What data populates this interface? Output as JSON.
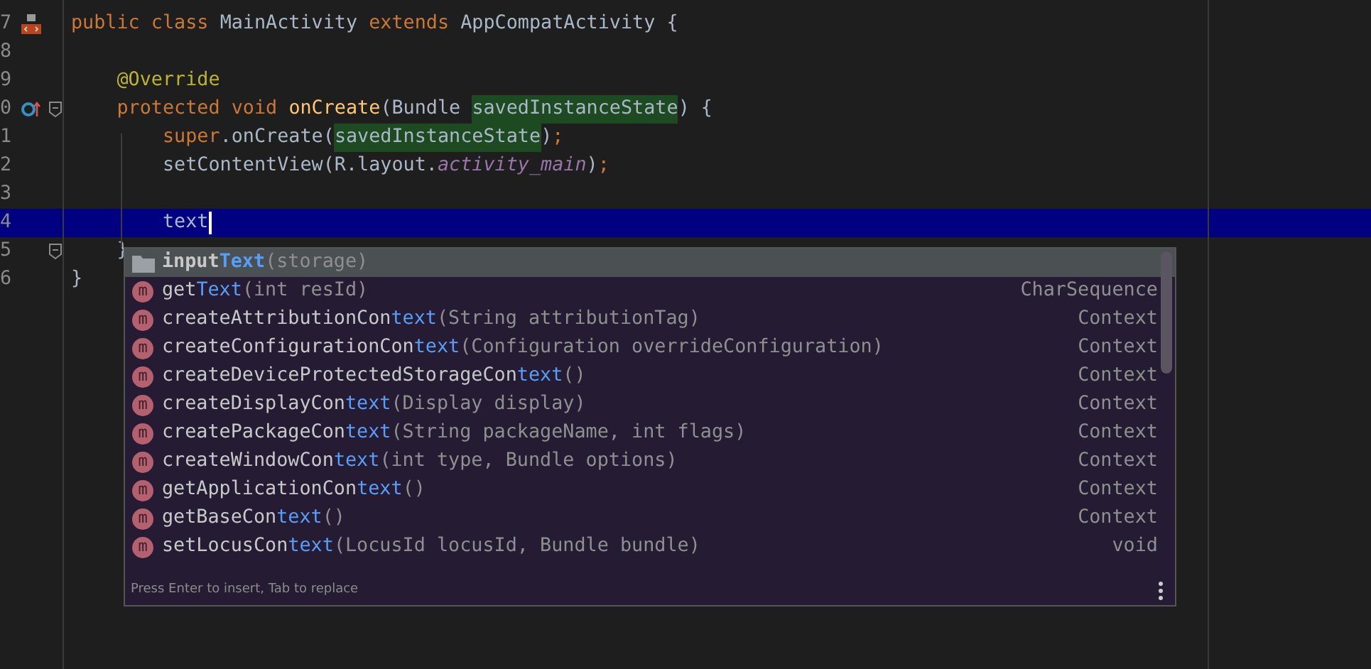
{
  "editor": {
    "lines": [
      {
        "number": "7",
        "kind": "class",
        "fold": false,
        "current": false,
        "segments": [
          {
            "kind": "keyword",
            "text": "public class "
          },
          {
            "kind": "plain",
            "text": "MainActivity "
          },
          {
            "kind": "keyword",
            "text": "extends "
          },
          {
            "kind": "plain",
            "text": "AppCompatActivity {"
          }
        ]
      },
      {
        "number": "8",
        "kind": "code",
        "current": false,
        "fold": false
      },
      {
        "number": "9",
        "kind": "code",
        "current": false,
        "fold": false,
        "segments": [
          {
            "kind": "annotation",
            "text": "    @Override"
          }
        ]
      },
      {
        "number": "0",
        "kind": "override",
        "fold": true,
        "current": false,
        "segments": [
          {
            "kind": "keyword",
            "text": "    protected void "
          },
          {
            "kind": "method",
            "text": "onCreate"
          },
          {
            "kind": "plain",
            "text": "(Bundle "
          },
          {
            "kind": "highlight",
            "text": "savedInstanceState"
          },
          {
            "kind": "plain",
            "text": ") {"
          }
        ]
      },
      {
        "number": "1",
        "kind": "code",
        "current": false,
        "fold": false,
        "segments": [
          {
            "kind": "keyword",
            "text": "        super"
          },
          {
            "kind": "plain",
            "text": ".onCreate("
          },
          {
            "kind": "highlight",
            "text": "savedInstanceState"
          },
          {
            "kind": "plain",
            "text": ")"
          },
          {
            "kind": "keyword",
            "text": ";"
          }
        ]
      },
      {
        "number": "2",
        "kind": "code",
        "current": false,
        "fold": false,
        "segments": [
          {
            "kind": "plain",
            "text": "        setContentView(R.layout."
          },
          {
            "kind": "field",
            "text": "activity_main"
          },
          {
            "kind": "plain",
            "text": ")"
          },
          {
            "kind": "keyword",
            "text": ";"
          }
        ]
      },
      {
        "number": "3",
        "kind": "code",
        "current": false,
        "fold": false
      },
      {
        "number": "4",
        "kind": "code",
        "current": true,
        "fold": false,
        "segments": [
          {
            "kind": "plain",
            "text": "        text"
          }
        ]
      },
      {
        "number": "5",
        "kind": "code",
        "current": false,
        "fold": true,
        "segments": [
          {
            "kind": "plain",
            "text": "    }"
          }
        ]
      },
      {
        "number": "6",
        "kind": "code",
        "current": false,
        "fold": false,
        "segments": [
          {
            "kind": "plain",
            "text": "}"
          }
        ]
      }
    ]
  },
  "completion": {
    "items": [
      {
        "kind": "folder",
        "selected": true,
        "prefix": "input",
        "match": "Text",
        "params": "(storage)"
      },
      {
        "kind": "method",
        "glyph": "m",
        "selected": false,
        "prefix": "get",
        "match": "Text",
        "params": "(int resId)",
        "type": "CharSequence"
      },
      {
        "kind": "method",
        "glyph": "m",
        "selected": false,
        "prefix": "createAttributionCon",
        "match": "text",
        "params": "(String attributionTag)",
        "type": "Context"
      },
      {
        "kind": "method",
        "glyph": "m",
        "selected": false,
        "prefix": "createConfigurationCon",
        "match": "text",
        "params": "(Configuration overrideConfiguration)",
        "type": "Context"
      },
      {
        "kind": "method",
        "glyph": "m",
        "selected": false,
        "prefix": "createDeviceProtectedStorageCon",
        "match": "text",
        "params": "()",
        "type": "Context"
      },
      {
        "kind": "method",
        "glyph": "m",
        "selected": false,
        "prefix": "createDisplayCon",
        "match": "text",
        "params": "(Display display)",
        "type": "Context"
      },
      {
        "kind": "method",
        "glyph": "m",
        "selected": false,
        "prefix": "createPackageCon",
        "match": "text",
        "params": "(String packageName, int flags)",
        "type": "Context"
      },
      {
        "kind": "method",
        "glyph": "m",
        "selected": false,
        "prefix": "createWindowCon",
        "match": "text",
        "params": "(int type, Bundle options)",
        "type": "Context"
      },
      {
        "kind": "method",
        "glyph": "m",
        "selected": false,
        "prefix": "getApplicationCon",
        "match": "text",
        "params": "()",
        "type": "Context"
      },
      {
        "kind": "method",
        "glyph": "m",
        "selected": false,
        "prefix": "getBaseCon",
        "match": "text",
        "params": "()",
        "type": "Context"
      },
      {
        "kind": "method",
        "glyph": "m",
        "selected": false,
        "prefix": "setLocusCon",
        "match": "text",
        "params": "(LocusId locusId, Bundle bundle)",
        "type": "void"
      }
    ],
    "hint": "Press Enter to insert, Tab to replace"
  }
}
